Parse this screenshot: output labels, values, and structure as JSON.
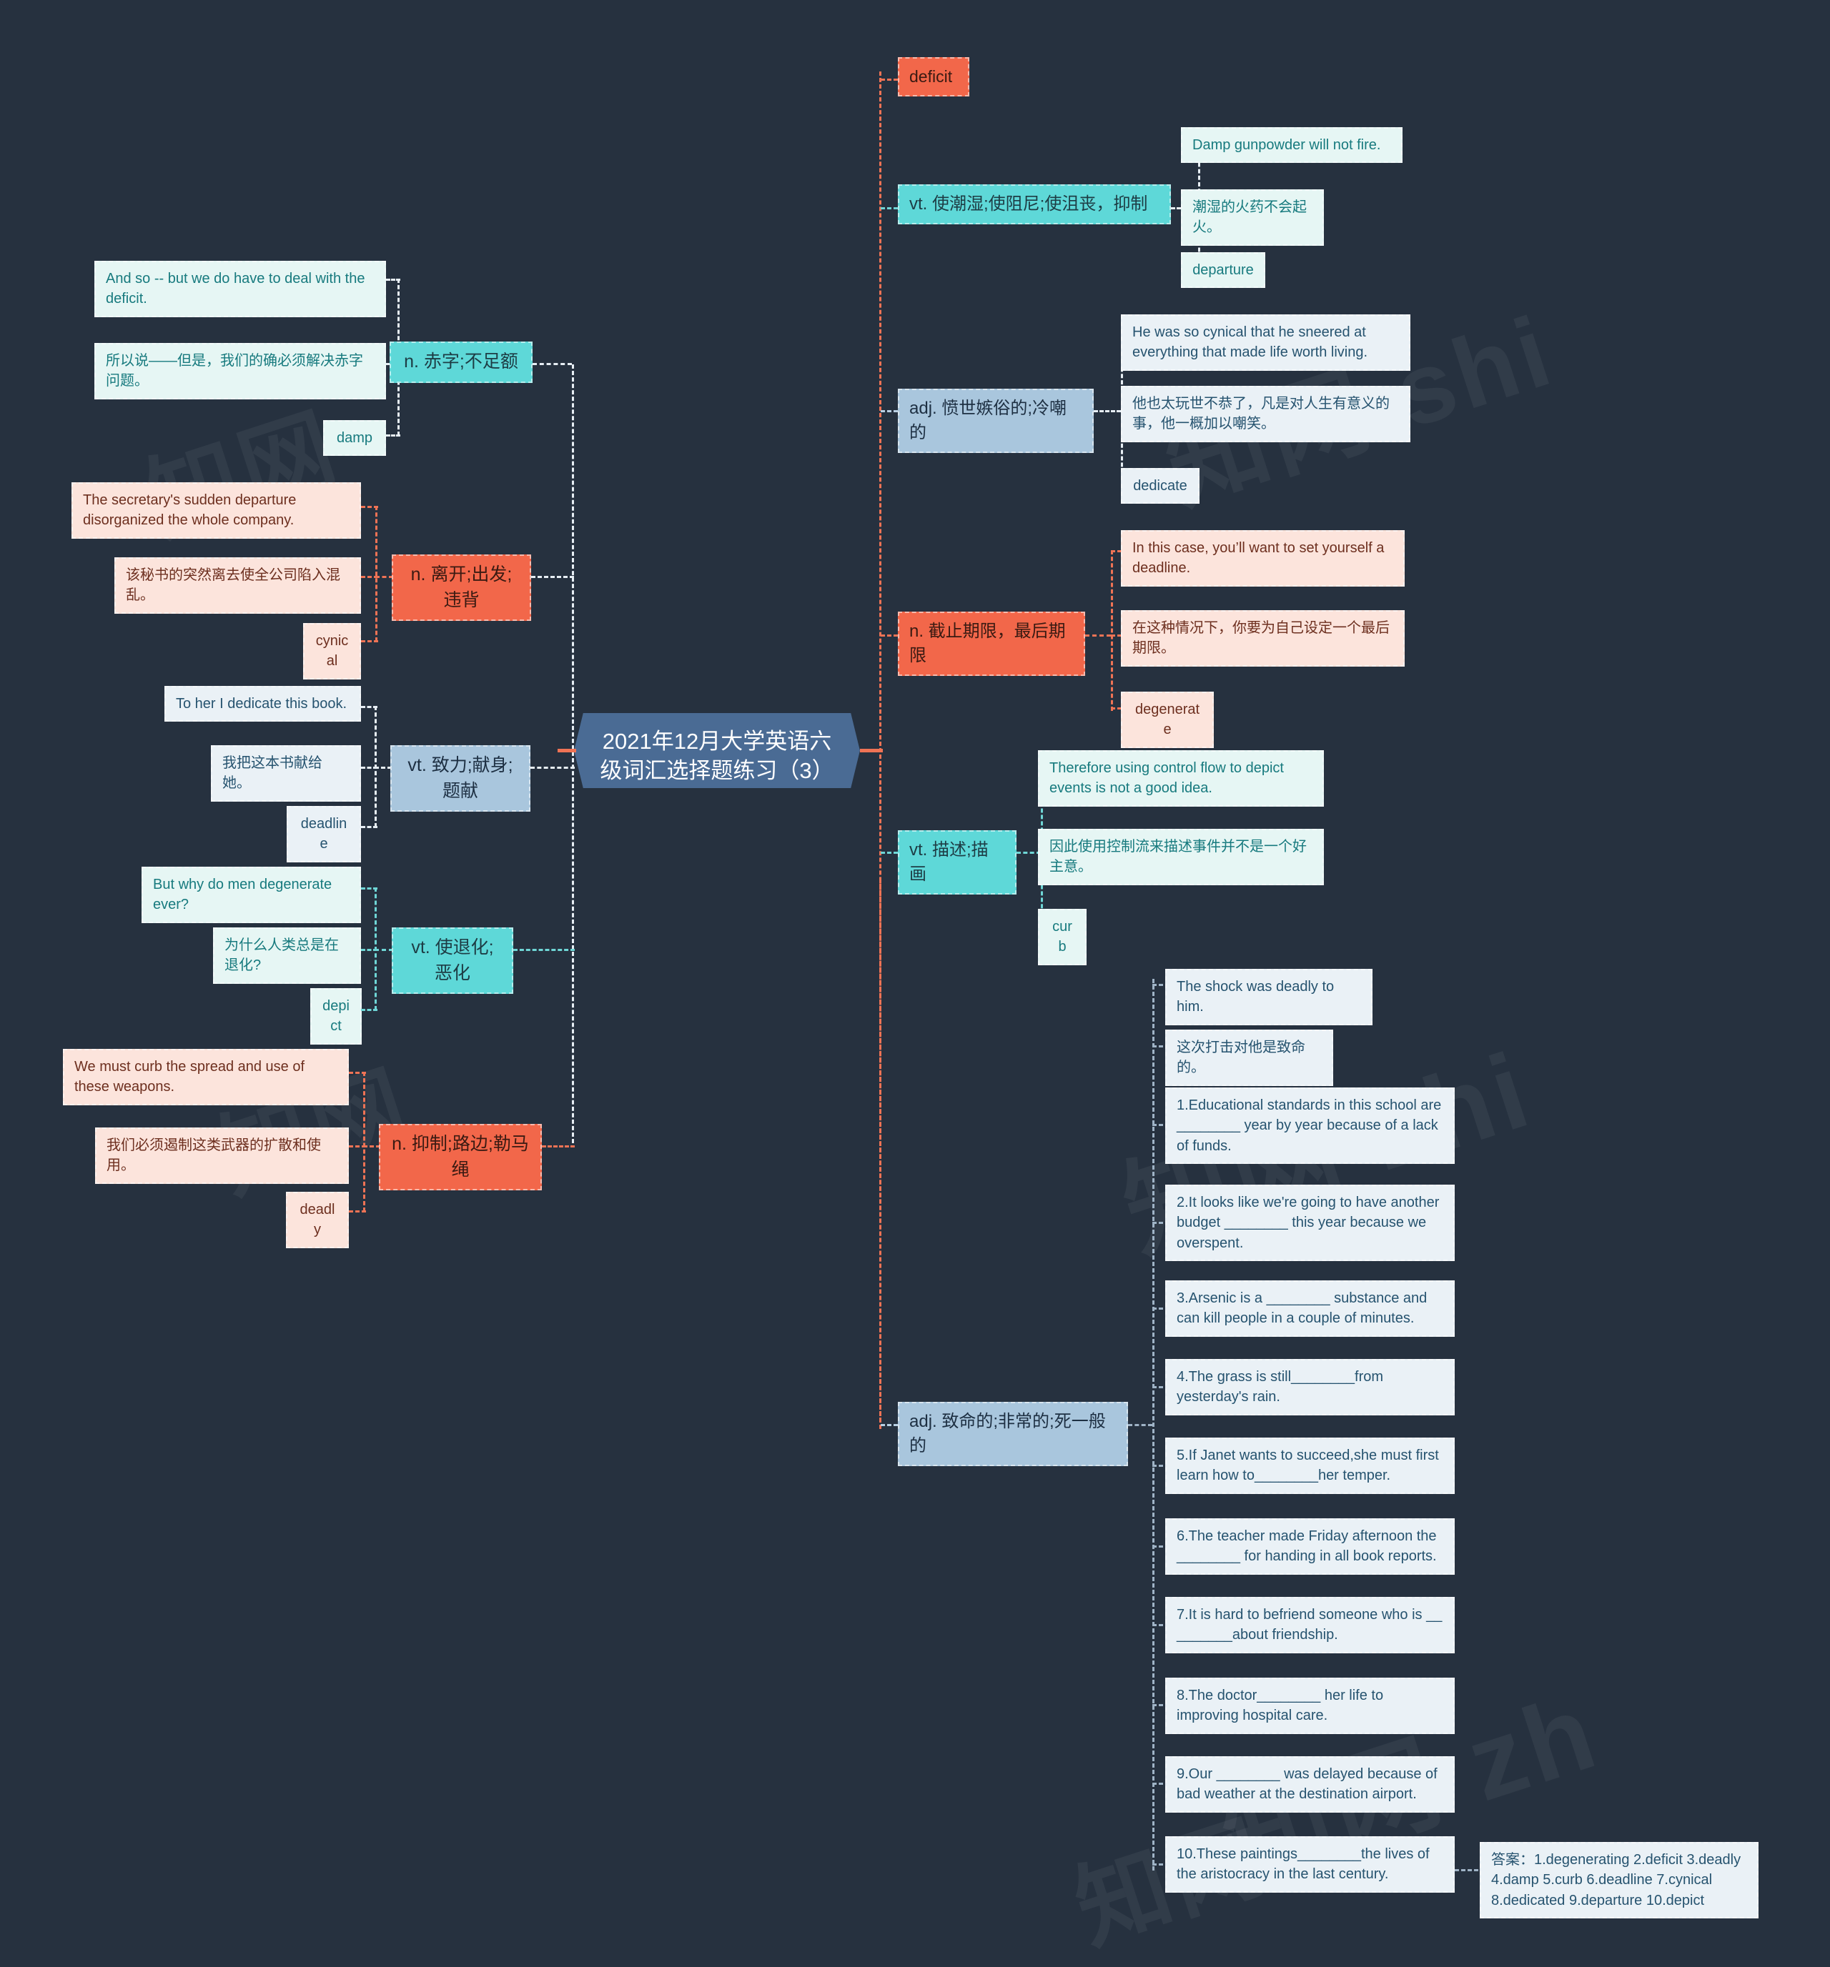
{
  "root": {
    "title": "2021年12月大学英语六级词汇选择题练习（3）"
  },
  "colors": {
    "background": "#26313f",
    "root_fill": "#4a6b94",
    "cyan": "#5ed8d8",
    "orange": "#f2674a",
    "blue": "#a9c6dd",
    "leaf_cyan": "#e6f6f4",
    "leaf_orange": "#fce4dc",
    "leaf_blue": "#eaf1f6"
  },
  "left_branches": [
    {
      "topic": "n. 赤字;不足额",
      "theme": "cyan",
      "leaves": [
        "And so -- but we do have to deal with the deficit.",
        "所以说——但是，我们的确必须解决赤字问题。",
        "damp"
      ]
    },
    {
      "topic": "n. 离开;出发;违背",
      "theme": "orange",
      "leaves": [
        "The secretary's sudden departure disorganized the whole company.",
        "该秘书的突然离去使全公司陷入混乱。",
        "cynical"
      ]
    },
    {
      "topic": "vt. 致力;献身;题献",
      "theme": "blue",
      "leaves": [
        "To her I dedicate this book.",
        "我把这本书献给她。",
        "deadline"
      ]
    },
    {
      "topic": "vt. 使退化;恶化",
      "theme": "cyan",
      "leaves": [
        "But why do men degenerate ever?",
        "为什么人类总是在退化?",
        "depict"
      ]
    },
    {
      "topic": "n. 抑制;路边;勒马绳",
      "theme": "orange",
      "leaves": [
        "We must curb the spread and use of these weapons.",
        "我们必须遏制这类武器的扩散和使用。",
        "deadly"
      ]
    }
  ],
  "right_branches": [
    {
      "topic": "deficit",
      "theme": "orange",
      "is_word": true,
      "leaves": []
    },
    {
      "topic": "vt. 使潮湿;使阻尼;使沮丧，抑制",
      "theme": "cyan",
      "leaves": [
        "Damp gunpowder will not fire.",
        "潮湿的火药不会起火。",
        "departure"
      ]
    },
    {
      "topic": "adj. 愤世嫉俗的;冷嘲的",
      "theme": "blue",
      "leaves": [
        "He was so cynical that he sneered at everything that made life worth living.",
        "他也太玩世不恭了，凡是对人生有意义的事，他一概加以嘲笑。",
        "dedicate"
      ]
    },
    {
      "topic": "n. 截止期限，最后期限",
      "theme": "orange",
      "leaves": [
        "In this case, you’ll want to set yourself a deadline.",
        "在这种情况下，你要为自己设定一个最后期限。",
        "degenerate"
      ]
    },
    {
      "topic": "vt. 描述;描画",
      "theme": "cyan",
      "leaves": [
        "Therefore using control flow to depict events is not a good idea.",
        "因此使用控制流来描述事件并不是一个好主意。",
        "curb"
      ]
    },
    {
      "topic": "adj. 致命的;非常的;死一般的",
      "theme": "blue",
      "leaves": [
        "The shock was deadly to him.",
        "这次打击对他是致命的。",
        "1.Educational standards in this school are ________ year by year because of a lack of funds.",
        "2.It looks like we're going to have another budget ________ this year because we overspent.",
        "3.Arsenic is a ________ substance and can kill people in a couple of minutes.",
        "4.The grass is still________from yesterday's rain.",
        "5.If Janet wants to succeed,she must first learn how to________her temper.",
        "6.The teacher made Friday afternoon the ________ for handing in all book reports.",
        "7.It is hard to befriend someone who is __ _______about friendship.",
        "8.The doctor________ her life to improving hospital care.",
        "9.Our ________ was delayed because of bad weather at the destination airport.",
        "10.These paintings________the lives of the aristocracy in the last century."
      ]
    }
  ],
  "answer_key": "答案：1.degenerating 2.deficit 3.deadly 4.damp 5.curb 6.deadline 7.cynical 8.dedicated 9.departure 10.depict",
  "watermarks": [
    "zhihu",
    "知网",
    "shuu"
  ]
}
